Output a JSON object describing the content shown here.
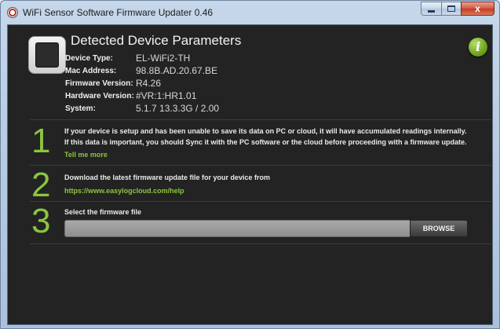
{
  "window": {
    "title": "WiFi Sensor Software Firmware Updater 0.46",
    "close_label": "x"
  },
  "device": {
    "section_title": "Detected Device Parameters",
    "params": [
      {
        "label": "Device Type:",
        "value": "EL-WiFi2-TH"
      },
      {
        "label": "Mac Address:",
        "value": "98.8B.AD.20.67.BE"
      },
      {
        "label": "Firmware Version:",
        "value": "R4.26"
      },
      {
        "label": "Hardware Version:",
        "value": "#VR:1:HR1.01"
      },
      {
        "label": "System:",
        "value": "5.1.7 13.3.3G / 2.00"
      }
    ],
    "info_icon": "i"
  },
  "steps": [
    {
      "number": "1",
      "lines": [
        "If your device is setup and has been unable to save its data on PC or cloud, it will have accumulated readings internally.",
        "If this data is important, you should Sync it with the PC software or the cloud before proceeding with a firmware update."
      ],
      "link": "Tell me more"
    },
    {
      "number": "2",
      "lines": [
        "Download the latest firmware update file for your device from"
      ],
      "link": "https://www.easylogcloud.com/help"
    },
    {
      "number": "3",
      "lines": [
        "Select the firmware file"
      ],
      "field_value": "",
      "button": "BROWSE"
    }
  ],
  "colors": {
    "accent": "#8bc53f",
    "background": "#232323"
  }
}
